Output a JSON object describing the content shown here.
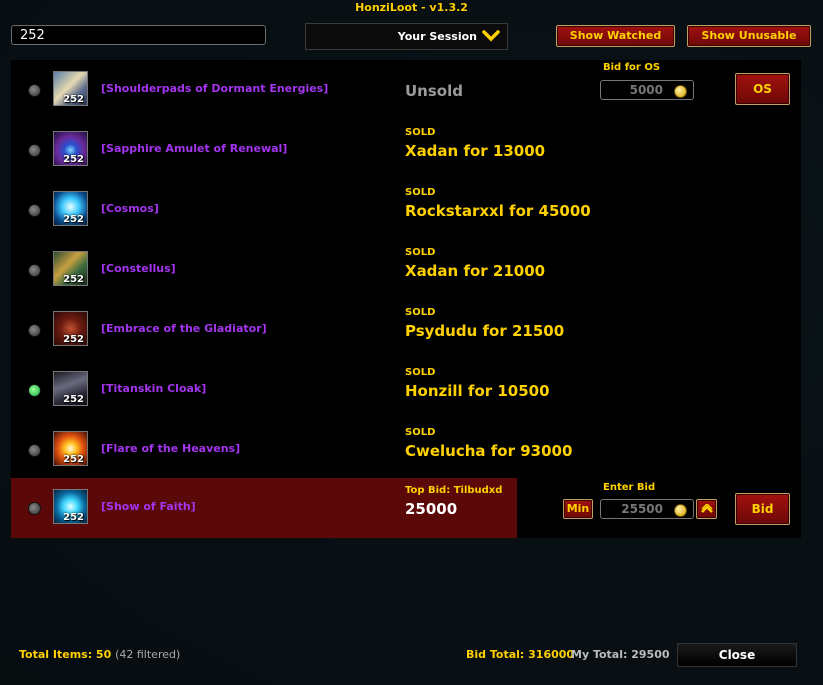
{
  "window": {
    "title": "HonziLoot - v1.3.2"
  },
  "search": {
    "value": "252"
  },
  "session_dropdown": {
    "label": "Your Session"
  },
  "buttons": {
    "show_watched": "Show Watched",
    "show_unusable": "Show Unusable",
    "close": "Close"
  },
  "colors": {
    "accent": "#ffd100",
    "epic": "#a335ee",
    "button_red": "#a1110e",
    "active_row": "#5b0808"
  },
  "items": [
    {
      "name": "[Shoulderpads of Dormant Energies]",
      "ilvl": "252",
      "status": "",
      "result": "Unsold",
      "icon": "shoulder-icon",
      "indicator": "grey"
    },
    {
      "name": "[Sapphire Amulet of Renewal]",
      "ilvl": "252",
      "status": "SOLD",
      "result": "Xadan for 13000",
      "icon": "amulet-icon",
      "indicator": "grey"
    },
    {
      "name": "[Cosmos]",
      "ilvl": "252",
      "status": "SOLD",
      "result": "Rockstarxxl for 45000",
      "icon": "staff-icon",
      "indicator": "grey"
    },
    {
      "name": "[Constellus]",
      "ilvl": "252",
      "status": "SOLD",
      "result": "Xadan for 21000",
      "icon": "mace-icon",
      "indicator": "grey"
    },
    {
      "name": "[Embrace of the Gladiator]",
      "ilvl": "252",
      "status": "SOLD",
      "result": "Psydudu for 21500",
      "icon": "chest-armor-icon",
      "indicator": "grey"
    },
    {
      "name": "[Titanskin Cloak]",
      "ilvl": "252",
      "status": "SOLD",
      "result": "Honzill for 10500",
      "icon": "cloak-icon",
      "indicator": "green"
    },
    {
      "name": "[Flare of the Heavens]",
      "ilvl": "252",
      "status": "SOLD",
      "result": "Cwelucha for 93000",
      "icon": "trinket-flare-icon",
      "indicator": "grey"
    },
    {
      "name": "[Show of Faith]",
      "ilvl": "252",
      "status": "Top Bid:  Tilbudxd",
      "result": "25000",
      "icon": "trinket-faith-icon",
      "indicator": "grey"
    }
  ],
  "os_bid": {
    "label": "Bid for OS",
    "value": "5000",
    "button": "OS"
  },
  "active_bid": {
    "label": "Enter Bid",
    "value": "25500",
    "min_button": "Min",
    "bid_button": "Bid"
  },
  "footer": {
    "total_items_label": "Total Items: 50",
    "filtered": "(42 filtered)",
    "bid_total": "Bid Total: 316000",
    "my_total_label": "My Total:",
    "my_total_value": "29500"
  }
}
